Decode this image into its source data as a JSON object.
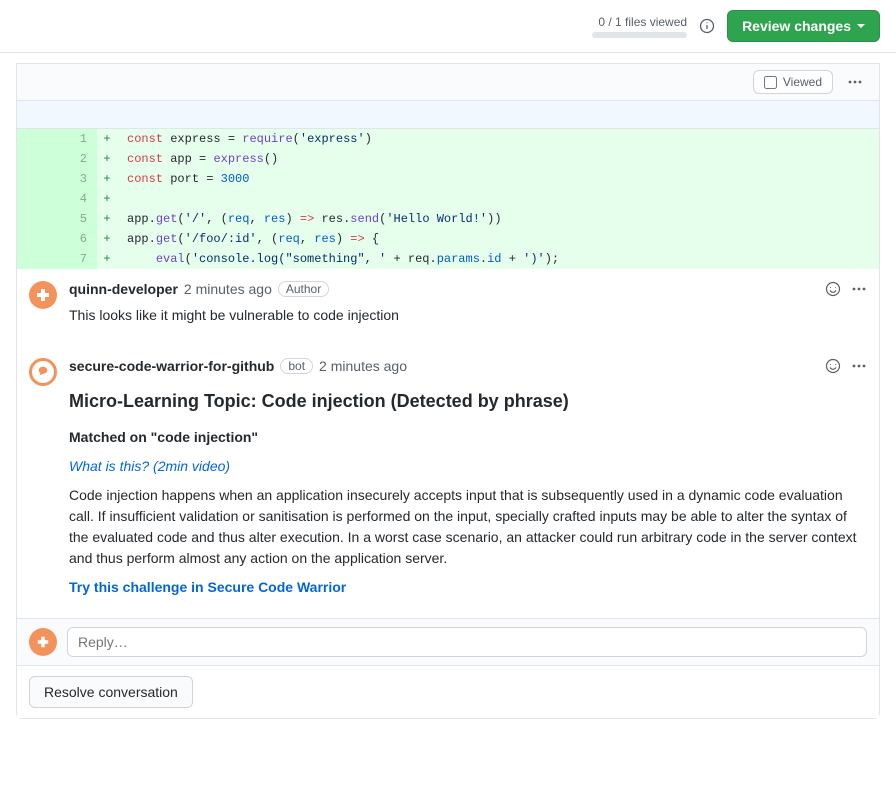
{
  "topbar": {
    "files_viewed": "0 / 1 files viewed",
    "review_label": "Review changes"
  },
  "file_header": {
    "viewed_label": "Viewed"
  },
  "diff": {
    "lines": [
      {
        "num": "1",
        "marker": "+",
        "tokens": [
          {
            "t": "const ",
            "c": "k"
          },
          {
            "t": "express",
            "c": ""
          },
          {
            "t": " = ",
            "c": ""
          },
          {
            "t": "require",
            "c": "fn"
          },
          {
            "t": "(",
            "c": ""
          },
          {
            "t": "'express'",
            "c": "s"
          },
          {
            "t": ")",
            "c": ""
          }
        ]
      },
      {
        "num": "2",
        "marker": "+",
        "tokens": [
          {
            "t": "const ",
            "c": "k"
          },
          {
            "t": "app",
            "c": ""
          },
          {
            "t": " = ",
            "c": ""
          },
          {
            "t": "express",
            "c": "fn"
          },
          {
            "t": "()",
            "c": ""
          }
        ]
      },
      {
        "num": "3",
        "marker": "+",
        "tokens": [
          {
            "t": "const ",
            "c": "k"
          },
          {
            "t": "port",
            "c": ""
          },
          {
            "t": " = ",
            "c": ""
          },
          {
            "t": "3000",
            "c": "n"
          }
        ]
      },
      {
        "num": "4",
        "marker": "+",
        "tokens": []
      },
      {
        "num": "5",
        "marker": "+",
        "tokens": [
          {
            "t": "app.",
            "c": ""
          },
          {
            "t": "get",
            "c": "fn"
          },
          {
            "t": "(",
            "c": ""
          },
          {
            "t": "'/'",
            "c": "s"
          },
          {
            "t": ", (",
            "c": ""
          },
          {
            "t": "req",
            "c": "p"
          },
          {
            "t": ", ",
            "c": ""
          },
          {
            "t": "res",
            "c": "p"
          },
          {
            "t": ") ",
            "c": ""
          },
          {
            "t": "=>",
            "c": "k"
          },
          {
            "t": " res.",
            "c": ""
          },
          {
            "t": "send",
            "c": "fn"
          },
          {
            "t": "(",
            "c": ""
          },
          {
            "t": "'Hello World!'",
            "c": "s"
          },
          {
            "t": "))",
            "c": ""
          }
        ]
      },
      {
        "num": "6",
        "marker": "+",
        "tokens": [
          {
            "t": "app.",
            "c": ""
          },
          {
            "t": "get",
            "c": "fn"
          },
          {
            "t": "(",
            "c": ""
          },
          {
            "t": "'/foo/:id'",
            "c": "s"
          },
          {
            "t": ", (",
            "c": ""
          },
          {
            "t": "req",
            "c": "p"
          },
          {
            "t": ", ",
            "c": ""
          },
          {
            "t": "res",
            "c": "p"
          },
          {
            "t": ") ",
            "c": ""
          },
          {
            "t": "=>",
            "c": "k"
          },
          {
            "t": " {",
            "c": ""
          }
        ]
      },
      {
        "num": "7",
        "marker": "+",
        "tokens": [
          {
            "t": "    ",
            "c": ""
          },
          {
            "t": "eval",
            "c": "fn"
          },
          {
            "t": "(",
            "c": ""
          },
          {
            "t": "'console.log(\"something\", '",
            "c": "s"
          },
          {
            "t": " + req.",
            "c": ""
          },
          {
            "t": "params",
            "c": "p"
          },
          {
            "t": ".",
            "c": ""
          },
          {
            "t": "id",
            "c": "p"
          },
          {
            "t": " + ",
            "c": ""
          },
          {
            "t": "')'",
            "c": "s"
          },
          {
            "t": ");",
            "c": ""
          }
        ]
      }
    ]
  },
  "comments": [
    {
      "author": "quinn-developer",
      "time": "2 minutes ago",
      "author_badge": "Author",
      "body_text": "This looks like it might be vulnerable to code injection"
    },
    {
      "author": "secure-code-warrior-for-github",
      "bot_badge": "bot",
      "time": "2 minutes ago",
      "heading": "Micro-Learning Topic: Code injection (Detected by phrase)",
      "subheading": "Matched on \"code injection\"",
      "video_link": "What is this? (2min video)",
      "description": "Code injection happens when an application insecurely accepts input that is subsequently used in a dynamic code evaluation call. If insufficient validation or sanitisation is performed on the input, specially crafted inputs may be able to alter the syntax of the evaluated code and thus alter execution. In a worst case scenario, an attacker could run arbitrary code in the server context and thus perform almost any action on the application server.",
      "challenge_link": "Try this challenge in Secure Code Warrior"
    }
  ],
  "reply": {
    "placeholder": "Reply…"
  },
  "resolve": {
    "label": "Resolve conversation"
  }
}
